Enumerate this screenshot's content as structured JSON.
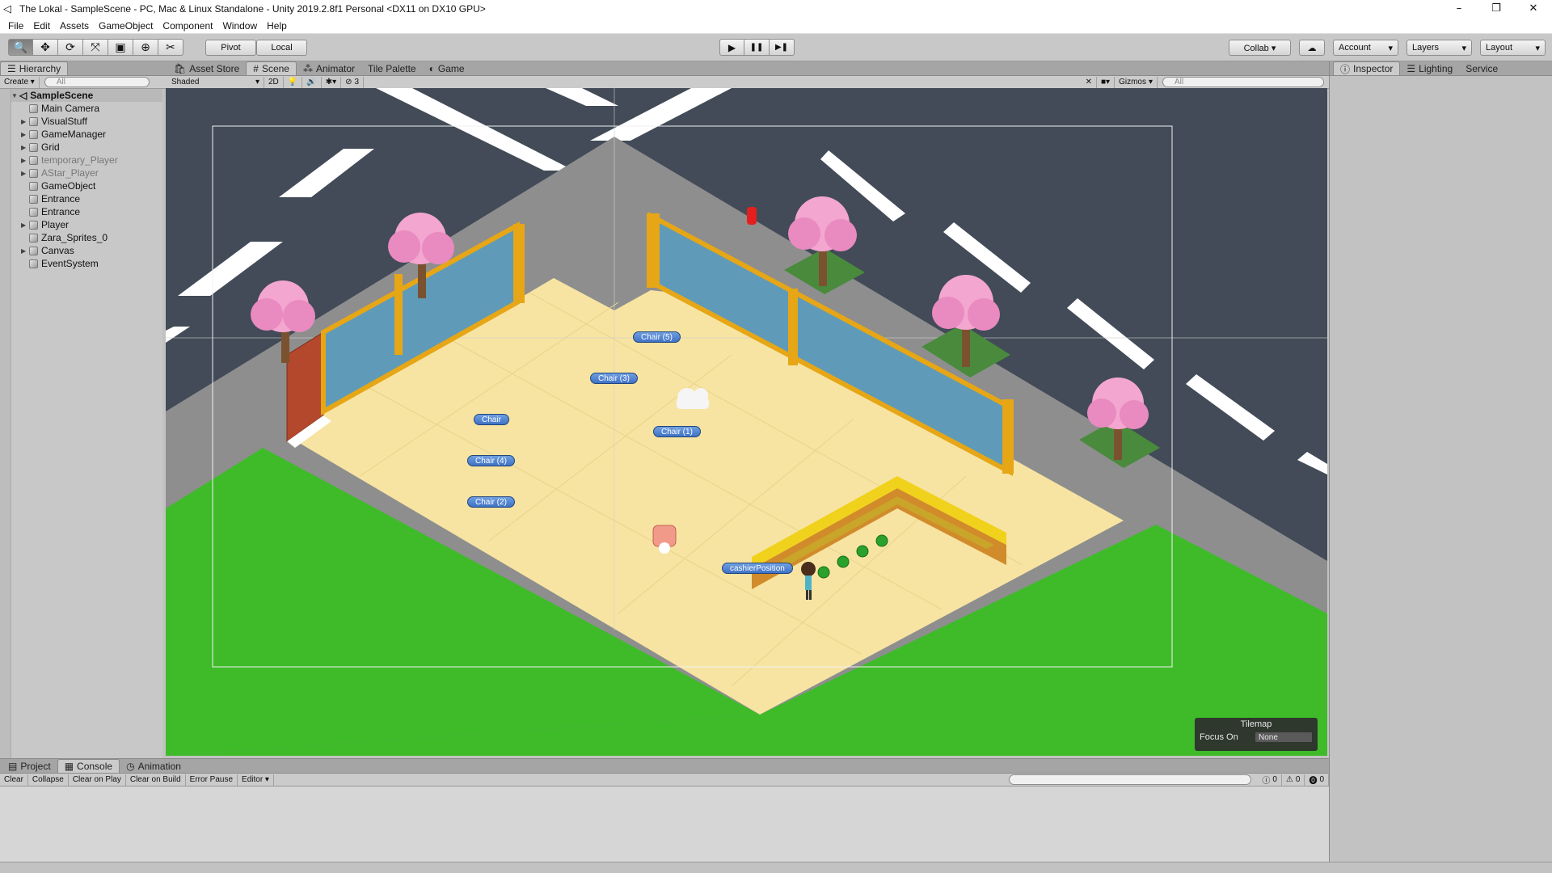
{
  "window": {
    "title": "The Lokal - SampleScene - PC, Mac & Linux Standalone - Unity 2019.2.8f1 Personal <DX11 on DX10 GPU>",
    "minimize": "–",
    "restore": "❐",
    "close": "✕"
  },
  "menu": [
    "File",
    "Edit",
    "Assets",
    "GameObject",
    "Component",
    "Window",
    "Help"
  ],
  "toolbar": {
    "tools": [
      {
        "name": "hand-tool",
        "glyph": "🔍"
      },
      {
        "name": "move-tool",
        "glyph": "✥"
      },
      {
        "name": "rotate-tool",
        "glyph": "⟳"
      },
      {
        "name": "scale-tool",
        "glyph": "⤧"
      },
      {
        "name": "rect-tool",
        "glyph": "▣"
      },
      {
        "name": "transform-tool",
        "glyph": "⊕"
      },
      {
        "name": "custom-tool",
        "glyph": "✂"
      }
    ],
    "pivot": "Pivot",
    "local": "Local",
    "play": "▶",
    "pause": "❚❚",
    "step": "▶❚",
    "collab": "Collab ▾",
    "cloud": "☁",
    "account": "Account",
    "layers": "Layers",
    "layout": "Layout"
  },
  "hierarchy": {
    "tab": "Hierarchy",
    "create": "Create ▾",
    "search_placeholder": "All",
    "scene": "SampleScene",
    "items": [
      {
        "label": "Main Camera",
        "expand": false,
        "dim": false
      },
      {
        "label": "VisualStuff",
        "expand": true,
        "dim": false
      },
      {
        "label": "GameManager",
        "expand": true,
        "dim": false
      },
      {
        "label": "Grid",
        "expand": true,
        "dim": false
      },
      {
        "label": "temporary_Player",
        "expand": true,
        "dim": true
      },
      {
        "label": "AStar_Player",
        "expand": true,
        "dim": true
      },
      {
        "label": "GameObject",
        "expand": false,
        "dim": false
      },
      {
        "label": "Entrance",
        "expand": false,
        "dim": false
      },
      {
        "label": "Entrance",
        "expand": false,
        "dim": false
      },
      {
        "label": "Player",
        "expand": true,
        "dim": false
      },
      {
        "label": "Zara_Sprites_0",
        "expand": false,
        "dim": false
      },
      {
        "label": "Canvas",
        "expand": true,
        "dim": false
      },
      {
        "label": "EventSystem",
        "expand": false,
        "dim": false
      }
    ]
  },
  "scene_tabs": [
    "Asset Store",
    "Scene",
    "Animator",
    "Tile Palette",
    "Game"
  ],
  "scene_toolbar": {
    "shading": "Shaded",
    "mode_2d": "2D",
    "hidden_count": "3",
    "gizmos": "Gizmos",
    "search_placeholder": "All"
  },
  "scene_labels": {
    "chair5": "Chair (5)",
    "chair3": "Chair (3)",
    "chair": "Chair",
    "chair1": "Chair (1)",
    "chair4": "Chair (4)",
    "chair2": "Chair (2)",
    "cashier": "cashierPosition"
  },
  "tilemap_overlay": {
    "title": "Tilemap",
    "focus_label": "Focus On",
    "focus_value": "None"
  },
  "inspector_tabs": [
    "Inspector",
    "Lighting",
    "Service"
  ],
  "bottom_tabs": [
    "Project",
    "Console",
    "Animation"
  ],
  "console": {
    "buttons": [
      "Clear",
      "Collapse",
      "Clear on Play",
      "Clear on Build",
      "Error Pause",
      "Editor ▾"
    ],
    "info_count": "0",
    "warn_count": "0",
    "error_count": "0"
  }
}
